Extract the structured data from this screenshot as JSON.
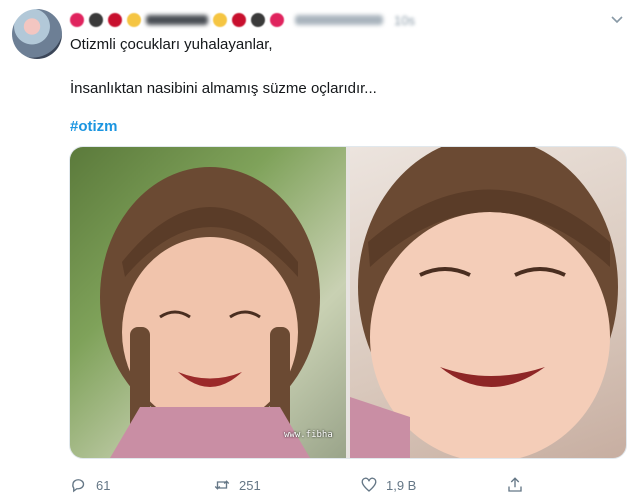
{
  "tweet": {
    "time": "10s",
    "line1": "Otizmli çocukları yuhalayanlar,",
    "line2": "İnsanlıktan nasibini almamış süzme oçlarıdır...",
    "hashtag": "#otizm",
    "watermark": "www.fibha",
    "reply_count": "61",
    "retweet_count": "251",
    "like_count": "1,9 B"
  },
  "colors": {
    "accent": "#1b95e0",
    "muted": "#657786"
  },
  "icons": {
    "reply": "reply-icon",
    "retweet": "retweet-icon",
    "like": "heart-icon",
    "share": "share-icon",
    "menu": "chevron-down-icon"
  }
}
